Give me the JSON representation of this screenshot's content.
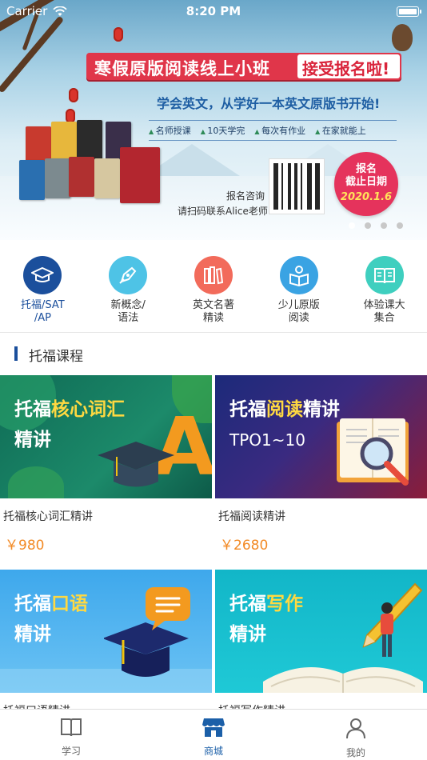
{
  "status_bar": {
    "carrier": "Carrier",
    "time": "8:20 PM"
  },
  "banner": {
    "title": "寒假原版阅读线上小班",
    "title_highlight": "接受报名啦!",
    "subtitle": "学会英文，从学好一本英文原版书开始!",
    "features": [
      "名师授课",
      "10天学完",
      "每次有作业",
      "在家就能上"
    ],
    "consult_line1": "报名咨询",
    "consult_line2": "请扫码联系Alice老师",
    "deadline_label_1": "报名",
    "deadline_label_2": "截止日期",
    "deadline_date": "2020.1.6",
    "page_count": 4,
    "active_page": 1
  },
  "categories": [
    {
      "label": "托福/SAT\n/AP",
      "icon": "graduation-cap-icon",
      "color": "#1b4f9c",
      "active": true
    },
    {
      "label": "新概念/\n语法",
      "icon": "pen-nib-icon",
      "color": "#4ec3e6",
      "active": false
    },
    {
      "label": "英文名著\n精读",
      "icon": "books-icon",
      "color": "#f26b5b",
      "active": false
    },
    {
      "label": "少儿原版\n阅读",
      "icon": "child-reading-icon",
      "color": "#3aa3e3",
      "active": false
    },
    {
      "label": "体验课大\n集合",
      "icon": "open-book-icon",
      "color": "#3fcfbf",
      "active": false
    }
  ],
  "section": {
    "title": "托福课程"
  },
  "courses": [
    {
      "img_title_1": "托福",
      "img_title_hl": "核心词汇",
      "img_title_2": "精讲",
      "name": "托福核心词汇精讲",
      "price": "￥980"
    },
    {
      "img_title_1": "托福",
      "img_title_hl": "阅读",
      "img_title_2": "精讲",
      "img_sub": "TPO1~10",
      "name": "托福阅读精讲",
      "price": "￥2680"
    },
    {
      "img_title_1": "托福",
      "img_title_hl": "口语",
      "img_title_2": "精讲",
      "name": "托福口语精讲",
      "price": ""
    },
    {
      "img_title_1": "托福",
      "img_title_hl": "写作",
      "img_title_2": "精讲",
      "name": "托福写作精讲",
      "price": ""
    }
  ],
  "tab_bar": {
    "tabs": [
      {
        "label": "学习",
        "icon": "book-icon",
        "active": false
      },
      {
        "label": "商城",
        "icon": "store-icon",
        "active": true
      },
      {
        "label": "我的",
        "icon": "person-icon",
        "active": false
      }
    ]
  }
}
